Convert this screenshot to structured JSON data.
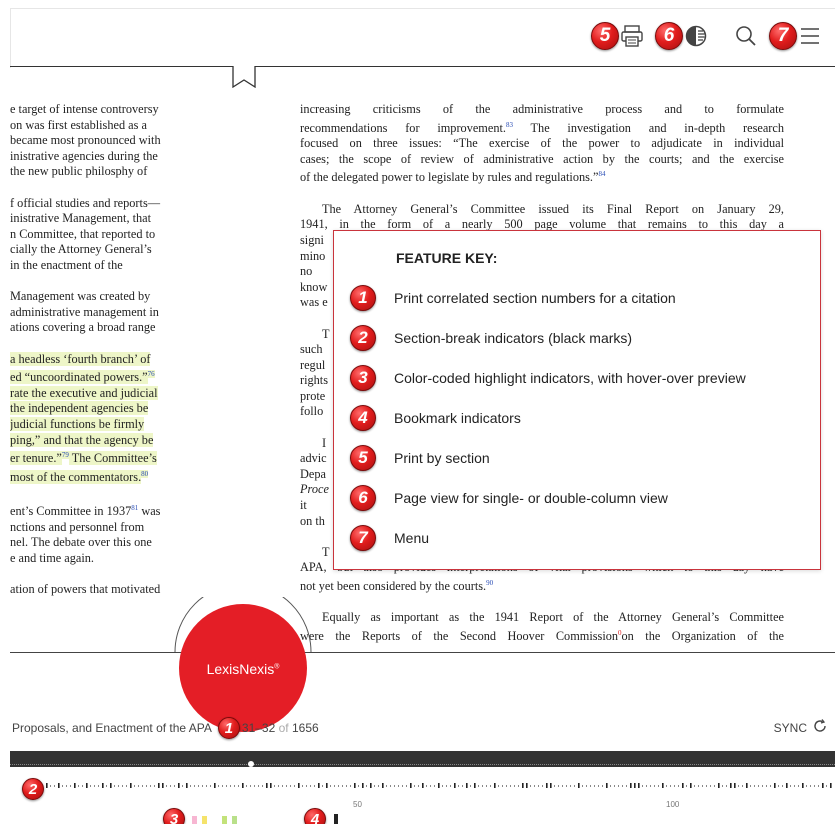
{
  "toolbar": {
    "print_section_badge": "5",
    "page_view_badge": "6",
    "menu_badge": "7",
    "icons": [
      "print-section-icon",
      "page-view-icon",
      "search-icon",
      "menu-icon"
    ]
  },
  "left_column": [
    {
      "text": "e target of intense controversy",
      "hl": false
    },
    {
      "text": "on was first established as a",
      "hl": false
    },
    {
      "text": "became most pronounced with",
      "hl": false
    },
    {
      "text": "inistrative agencies during the",
      "hl": false
    },
    {
      "text": " the new public philosphy of",
      "hl": false
    },
    {
      "gap": true
    },
    {
      "text": "f official studies and reports—",
      "hl": false
    },
    {
      "text": "inistrative Management, that",
      "hl": false
    },
    {
      "text": "n Committee, that reported to",
      "hl": false
    },
    {
      "text": "cially the Attorney General’s",
      "hl": false
    },
    {
      "text": " in the enactment of the",
      "hl": false
    },
    {
      "gap": true
    },
    {
      "text": " Management was created by",
      "hl": false
    },
    {
      "text": "administrative management in",
      "hl": false
    },
    {
      "text": "ations covering a broad range",
      "hl": false
    },
    {
      "gap": true
    },
    {
      "text": "a headless ‘fourth branch’ of",
      "hl": true
    },
    {
      "text": "ed “uncoordinated powers.”",
      "hl": true,
      "fn": "76"
    },
    {
      "text": "rate the executive and judicial",
      "hl": true
    },
    {
      "text": " the independent agencies be",
      "hl": true
    },
    {
      "text": "judicial functions be firmly",
      "hl": true
    },
    {
      "text": "ping,” and that the agency be",
      "hl": true
    },
    {
      "text": "er tenure.”",
      "hl": true,
      "fn": "79",
      "tail": " The Committee’s"
    },
    {
      "text": "most of the commentators.",
      "hl": true,
      "fn": "80"
    },
    {
      "gap": true
    },
    {
      "text": "ent’s Committee in 1937",
      "hl": false,
      "fn": "81",
      "tail": " was"
    },
    {
      "text": "nctions and personnel from",
      "hl": false
    },
    {
      "text": "nel. The debate over this one",
      "hl": false
    },
    {
      "text": "e and time again.",
      "hl": false
    },
    {
      "gap": true
    },
    {
      "text": "ation of powers that motivated",
      "hl": false
    }
  ],
  "right_column": [
    {
      "text": "increasing criticisms of the administrative process and to formulate"
    },
    {
      "text": "recommendations for improvement.",
      "fn": "83",
      "tail": " The investigation and in-depth research"
    },
    {
      "text": "focused on three issues: “The exercise of the power to adjudicate in individual"
    },
    {
      "text": "cases; the scope of review of administrative action by the courts; and the exercise"
    },
    {
      "text": "of the delegated power to legislate by rules and regulations.”",
      "fn": "84",
      "last": true
    },
    {
      "gap": true
    },
    {
      "text": "The Attorney General’s Committee issued its Final Report on January 29,",
      "indent": true
    },
    {
      "text": "1941, in the form of a nearly 500 page volume that remains to this day a"
    },
    {
      "text": "signi"
    },
    {
      "text": "mino"
    },
    {
      "text": "no ac"
    },
    {
      "text": "know"
    },
    {
      "text": "was e",
      "last": true
    },
    {
      "gap": true
    },
    {
      "text": "T",
      "indent": true
    },
    {
      "text": "such"
    },
    {
      "text": "regul"
    },
    {
      "text": "rights"
    },
    {
      "text": "prote"
    },
    {
      "text": "follo",
      "last": true
    },
    {
      "gap": true
    },
    {
      "text": "I",
      "indent": true
    },
    {
      "text": "advic"
    },
    {
      "text": "Depa"
    },
    {
      "text": "Proce",
      "italic": true
    },
    {
      "text": "it ren"
    },
    {
      "text": "on th",
      "last": true
    },
    {
      "gap": true
    },
    {
      "text": "T",
      "indent": true
    },
    {
      "text": "APA, but also provides interpretations of vital provisions which to this day have"
    },
    {
      "text": "not yet been considered by the courts.",
      "fn": "90",
      "last": true
    },
    {
      "gap": true
    },
    {
      "text": "Equally as important as the 1941 Report of the Attorney General’s Committee",
      "indent": true
    },
    {
      "text": "were the Reports of the Second Hoover Commission",
      "fnr": "0",
      "tail": "on the Organization of the"
    }
  ],
  "feature_key": {
    "title": "FEATURE KEY:",
    "items": [
      {
        "num": "1",
        "label": "Print correlated section numbers for a citation"
      },
      {
        "num": "2",
        "label": "Section-break indicators (black marks)"
      },
      {
        "num": "3",
        "label": "Color-coded highlight indicators, with hover-over preview"
      },
      {
        "num": "4",
        "label": "Bookmark indicators"
      },
      {
        "num": "5",
        "label": "Print by section"
      },
      {
        "num": "6",
        "label": "Page view for single- or double-column view"
      },
      {
        "num": "7",
        "label": "Menu"
      }
    ]
  },
  "logo": {
    "text": "LexisNexis",
    "mark": "®"
  },
  "footer": {
    "section_title": "Proposals, and Enactment of the APA",
    "badge": "1",
    "pages": "31–32",
    "of_label": "of",
    "total": "1656",
    "sync_label": "SYNC"
  },
  "timeline": {
    "section_badge": "2",
    "highlight_badge": "3",
    "bookmark_badge": "4",
    "tick_labels": [
      "50",
      "100"
    ],
    "highlight_colors": [
      "#f7b6d2",
      "#f5e36b",
      "#c3e27a",
      "#b9e08a"
    ],
    "accent": "#e11d1d"
  }
}
